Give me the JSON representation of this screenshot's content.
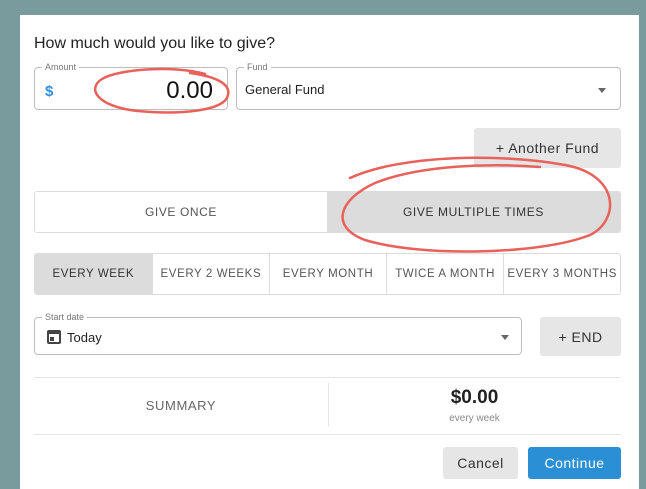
{
  "heading": "How much would you like to give?",
  "amount": {
    "legend": "Amount",
    "currency_symbol": "$",
    "value": "0.00"
  },
  "fund": {
    "legend": "Fund",
    "value": "General Fund"
  },
  "another_fund_label": "+ Another Fund",
  "give_options": [
    {
      "label": "GIVE ONCE",
      "selected": false
    },
    {
      "label": "GIVE MULTIPLE TIMES",
      "selected": true
    }
  ],
  "frequency_options": [
    {
      "label": "EVERY WEEK",
      "selected": true
    },
    {
      "label": "EVERY 2 WEEKS",
      "selected": false
    },
    {
      "label": "EVERY MONTH",
      "selected": false
    },
    {
      "label": "TWICE A MONTH",
      "selected": false
    },
    {
      "label": "EVERY 3 MONTHS",
      "selected": false
    }
  ],
  "start_date": {
    "legend": "Start date",
    "value": "Today",
    "icon": "calendar-icon"
  },
  "end_button_label": "+ END",
  "summary": {
    "label": "SUMMARY",
    "amount": "$0.00",
    "frequency": "every week"
  },
  "cancel_label": "Cancel",
  "continue_label": "Continue",
  "colors": {
    "accent": "#2b8fd6",
    "annotation": "#e8615a",
    "backdrop": "#7a9b9d"
  }
}
